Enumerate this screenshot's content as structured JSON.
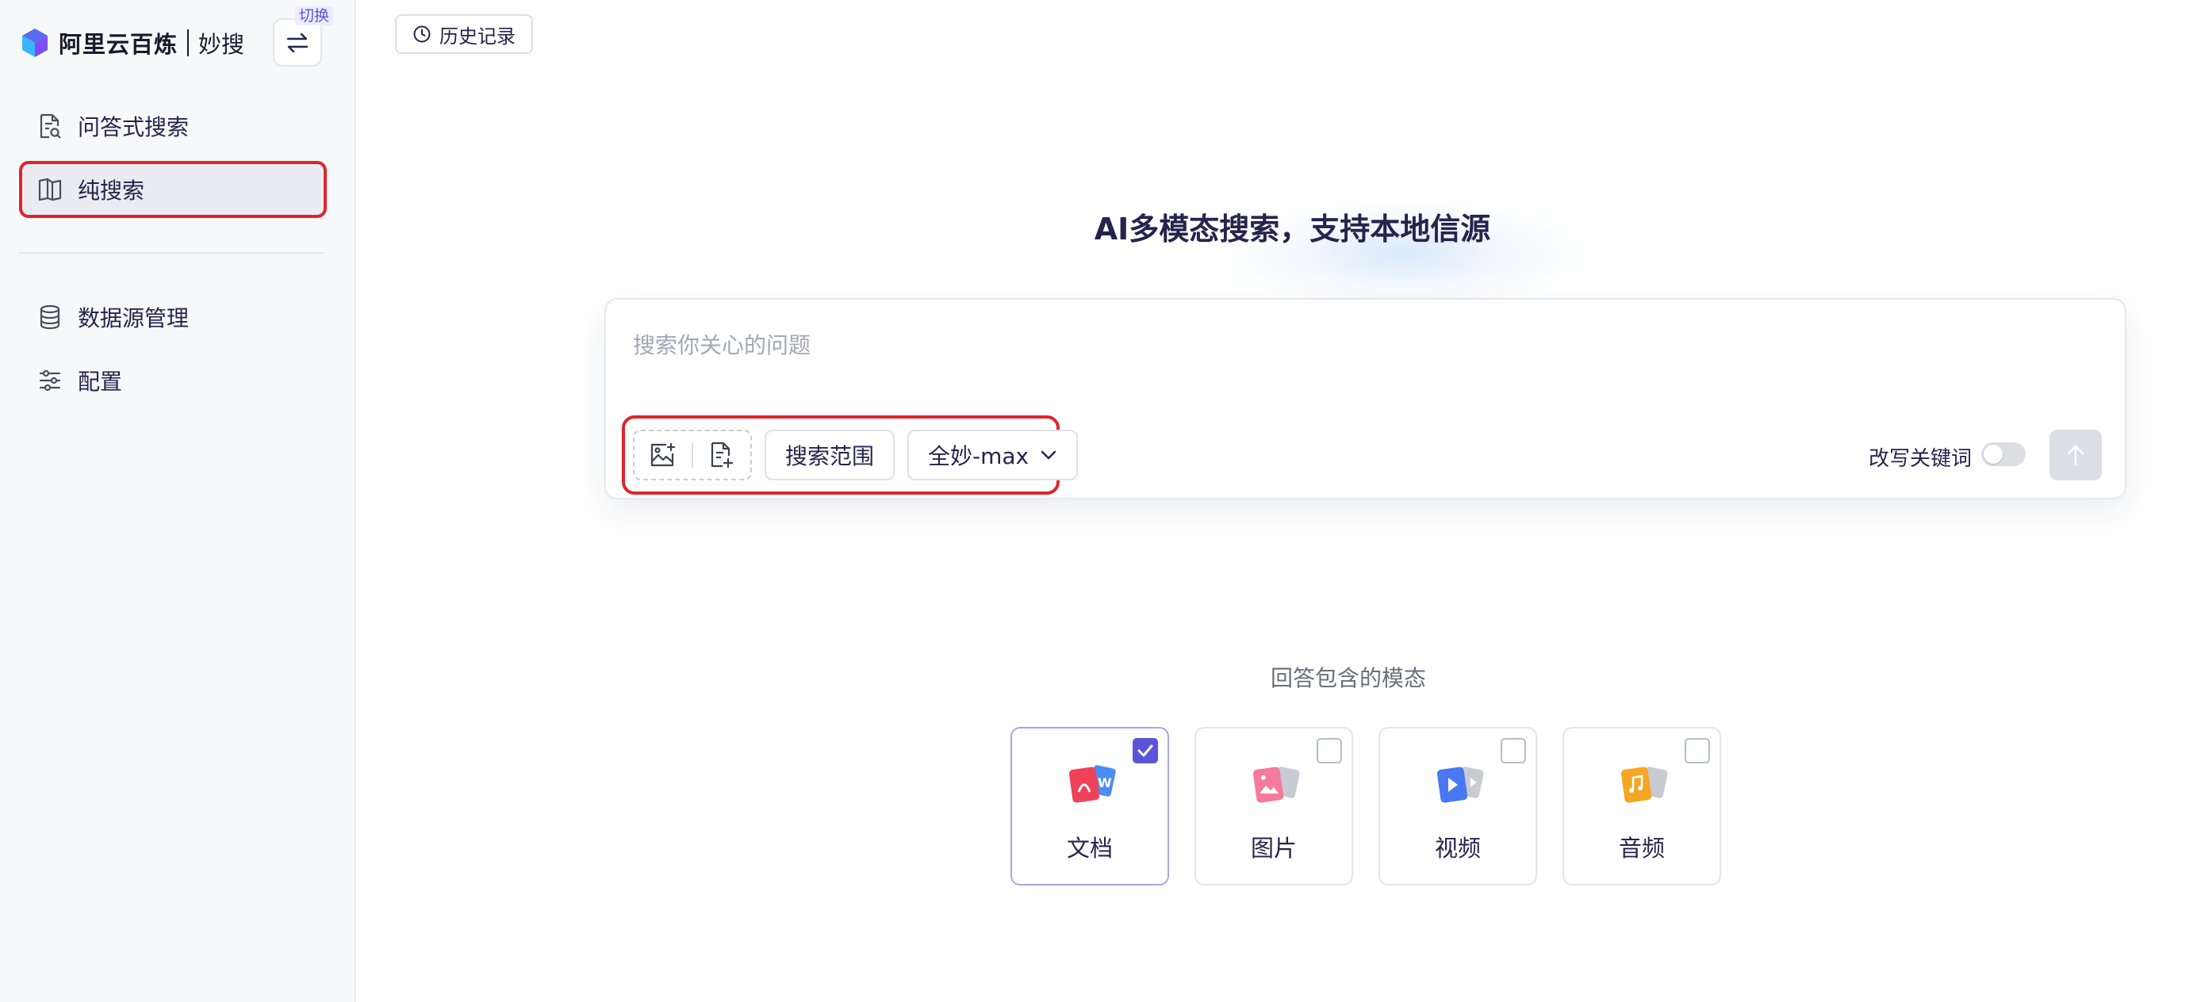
{
  "brand": {
    "name": "阿里云百炼",
    "product": "妙搜",
    "switch_tag": "切换"
  },
  "sidebar": {
    "items": [
      {
        "label": "问答式搜索",
        "icon": "doc-search-icon",
        "active": false
      },
      {
        "label": "纯搜索",
        "icon": "book-icon",
        "active": true
      },
      {
        "label": "数据源管理",
        "icon": "database-icon",
        "active": false
      },
      {
        "label": "配置",
        "icon": "sliders-icon",
        "active": false
      }
    ]
  },
  "header": {
    "history_label": "历史记录"
  },
  "hero": {
    "title": "AI多模态搜索，支持本地信源"
  },
  "search": {
    "placeholder": "搜索你关心的问题",
    "value": "",
    "range_label": "搜索范围",
    "model_label": "全妙-max",
    "rewrite_label": "改写关键词",
    "rewrite_enabled": false
  },
  "modalities": {
    "title": "回答包含的模态",
    "items": [
      {
        "label": "文档",
        "checked": true,
        "icon": "document-icon"
      },
      {
        "label": "图片",
        "checked": false,
        "icon": "image-icon"
      },
      {
        "label": "视频",
        "checked": false,
        "icon": "video-icon"
      },
      {
        "label": "音频",
        "checked": false,
        "icon": "audio-icon"
      }
    ]
  },
  "colors": {
    "accent": "#5a55d9",
    "highlight": "#e0242c",
    "text": "#26244c"
  }
}
